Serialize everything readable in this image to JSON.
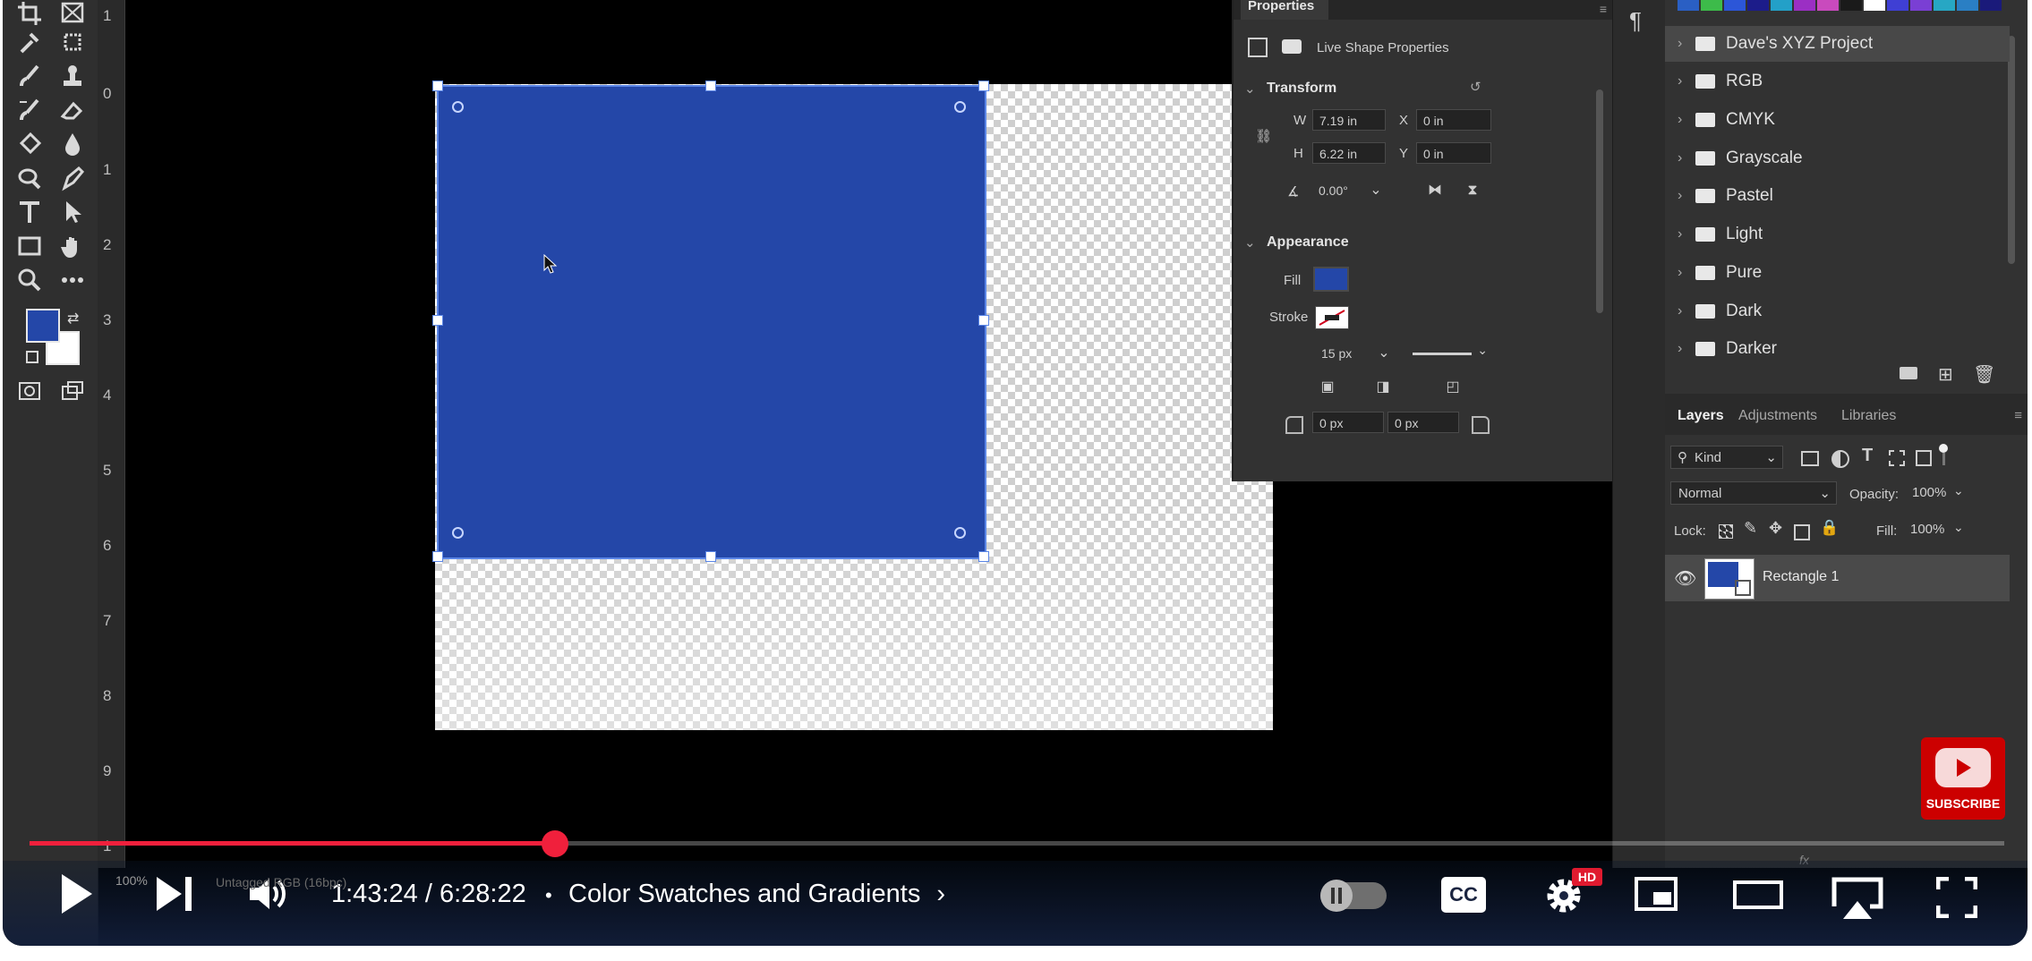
{
  "vertical_ruler": {
    "numbers": [
      "1",
      "0",
      "1",
      "2",
      "3",
      "4",
      "5",
      "6",
      "7",
      "8",
      "9",
      "1"
    ]
  },
  "properties_panel": {
    "tab": "Properties",
    "live_shape_label": "Live Shape Properties",
    "transform": {
      "heading": "Transform",
      "w_label": "W",
      "w_value": "7.19 in",
      "h_label": "H",
      "h_value": "6.22 in",
      "x_label": "X",
      "x_value": "0 in",
      "y_label": "Y",
      "y_value": "0 in",
      "angle_value": "0.00°"
    },
    "appearance": {
      "heading": "Appearance",
      "fill_label": "Fill",
      "stroke_label": "Stroke",
      "stroke_width": "15 px",
      "corner_a": "0 px",
      "corner_b": "0 px",
      "fill_color": "#2447a8"
    }
  },
  "swatches_panel": {
    "top_colors": [
      "#2a5fc4",
      "#3dbb4a",
      "#2c56d8",
      "#1c1c8a",
      "#23a0c8",
      "#9b2fc4",
      "#c94abd",
      "#1a1a1a",
      "#ffffff",
      "#3f3fd4",
      "#7a3fd4",
      "#27a7c4",
      "#2a7fc4",
      "#1a1a7a"
    ],
    "folders": [
      "Dave's XYZ Project",
      "RGB",
      "CMYK",
      "Grayscale",
      "Pastel",
      "Light",
      "Pure",
      "Dark",
      "Darker"
    ]
  },
  "layers_panel": {
    "tabs": [
      "Layers",
      "Adjustments",
      "Libraries"
    ],
    "filter_kind": "Kind",
    "blend_mode": "Normal",
    "opacity_label": "Opacity:",
    "opacity_value": "100%",
    "lock_label": "Lock:",
    "fill_label": "Fill:",
    "fill_value": "100%",
    "layer_name": "Rectangle 1"
  },
  "status_bar": {
    "zoom": "100%",
    "doc_info": "Untagged RGB (16bpc)"
  },
  "video_player": {
    "current_time": "1:43:24",
    "time_separator": "/",
    "duration": "6:28:22",
    "bullet": "•",
    "chapter_title": "Color Swatches and Gradients",
    "progress_fraction": 0.266,
    "quality_badge": "HD",
    "subscribe_label": "SUBSCRIBE",
    "accent_color": "#f0203c"
  }
}
